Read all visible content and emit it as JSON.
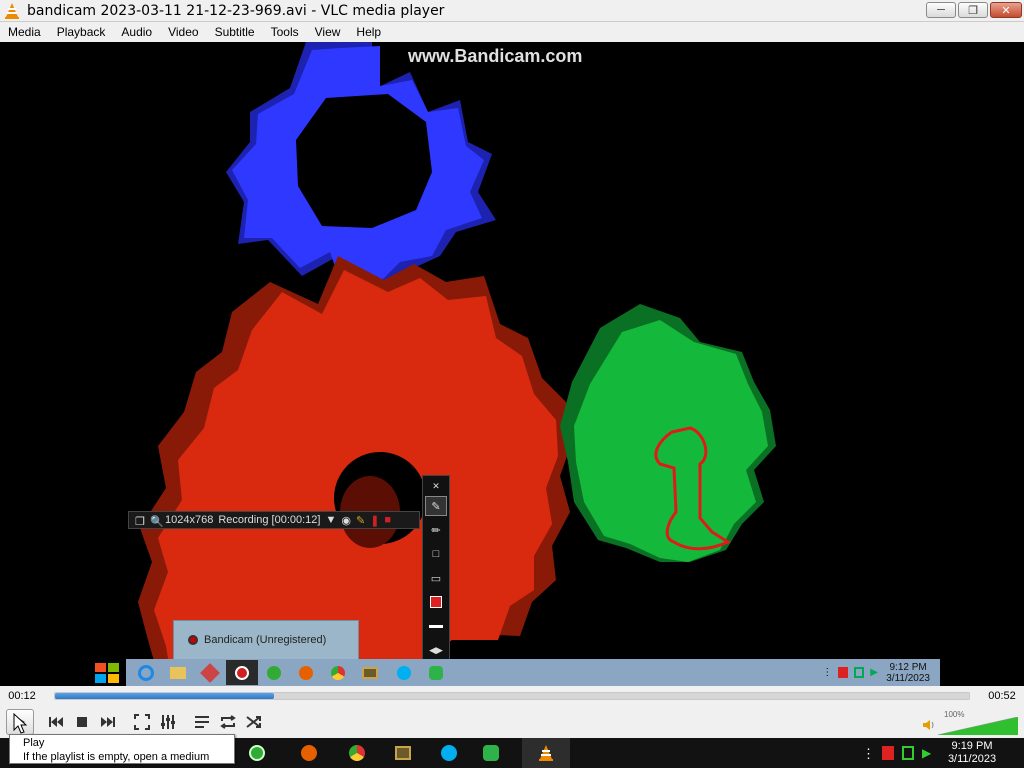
{
  "window": {
    "title": "bandicam 2023-03-11 21-12-23-969.avi - VLC media player",
    "minimize_icon": "minimize-icon",
    "maximize_icon": "restore-icon",
    "close_icon": "close-icon"
  },
  "menu": {
    "items": [
      "Media",
      "Playback",
      "Audio",
      "Video",
      "Subtitle",
      "Tools",
      "View",
      "Help"
    ]
  },
  "video": {
    "watermark": "www.Bandicam.com",
    "gear_colors": {
      "blue": "#2f38ff",
      "red": "#d92a10",
      "green": "#14b83a"
    },
    "bandicam_bar": {
      "resolution": "1024x768",
      "status": "Recording [00:00:12]"
    },
    "bandicam_notice": "Bandicam (Unregistered)",
    "bandicam_tools": [
      "pen-icon",
      "marker-icon",
      "rectangle-icon",
      "eraser-icon",
      "color-swatch-icon",
      "line-width-icon",
      "expand-icon"
    ],
    "inner_taskbar": {
      "time": "9:12 PM",
      "date": "3/11/2023"
    }
  },
  "seek": {
    "elapsed": "00:12",
    "total": "00:52",
    "progress": 0.24
  },
  "controls": {
    "buttons": [
      "play-icon",
      "previous-icon",
      "stop-icon",
      "next-icon",
      "fullscreen-icon",
      "extended-settings-icon",
      "playlist-icon",
      "loop-icon",
      "shuffle-icon"
    ],
    "volume_percent": "100%",
    "volume_level": 1.0
  },
  "tooltip": {
    "title": "Play",
    "text": "If the playlist is empty, open a medium"
  },
  "taskbar": {
    "time": "9:19 PM",
    "date": "3/11/2023"
  }
}
